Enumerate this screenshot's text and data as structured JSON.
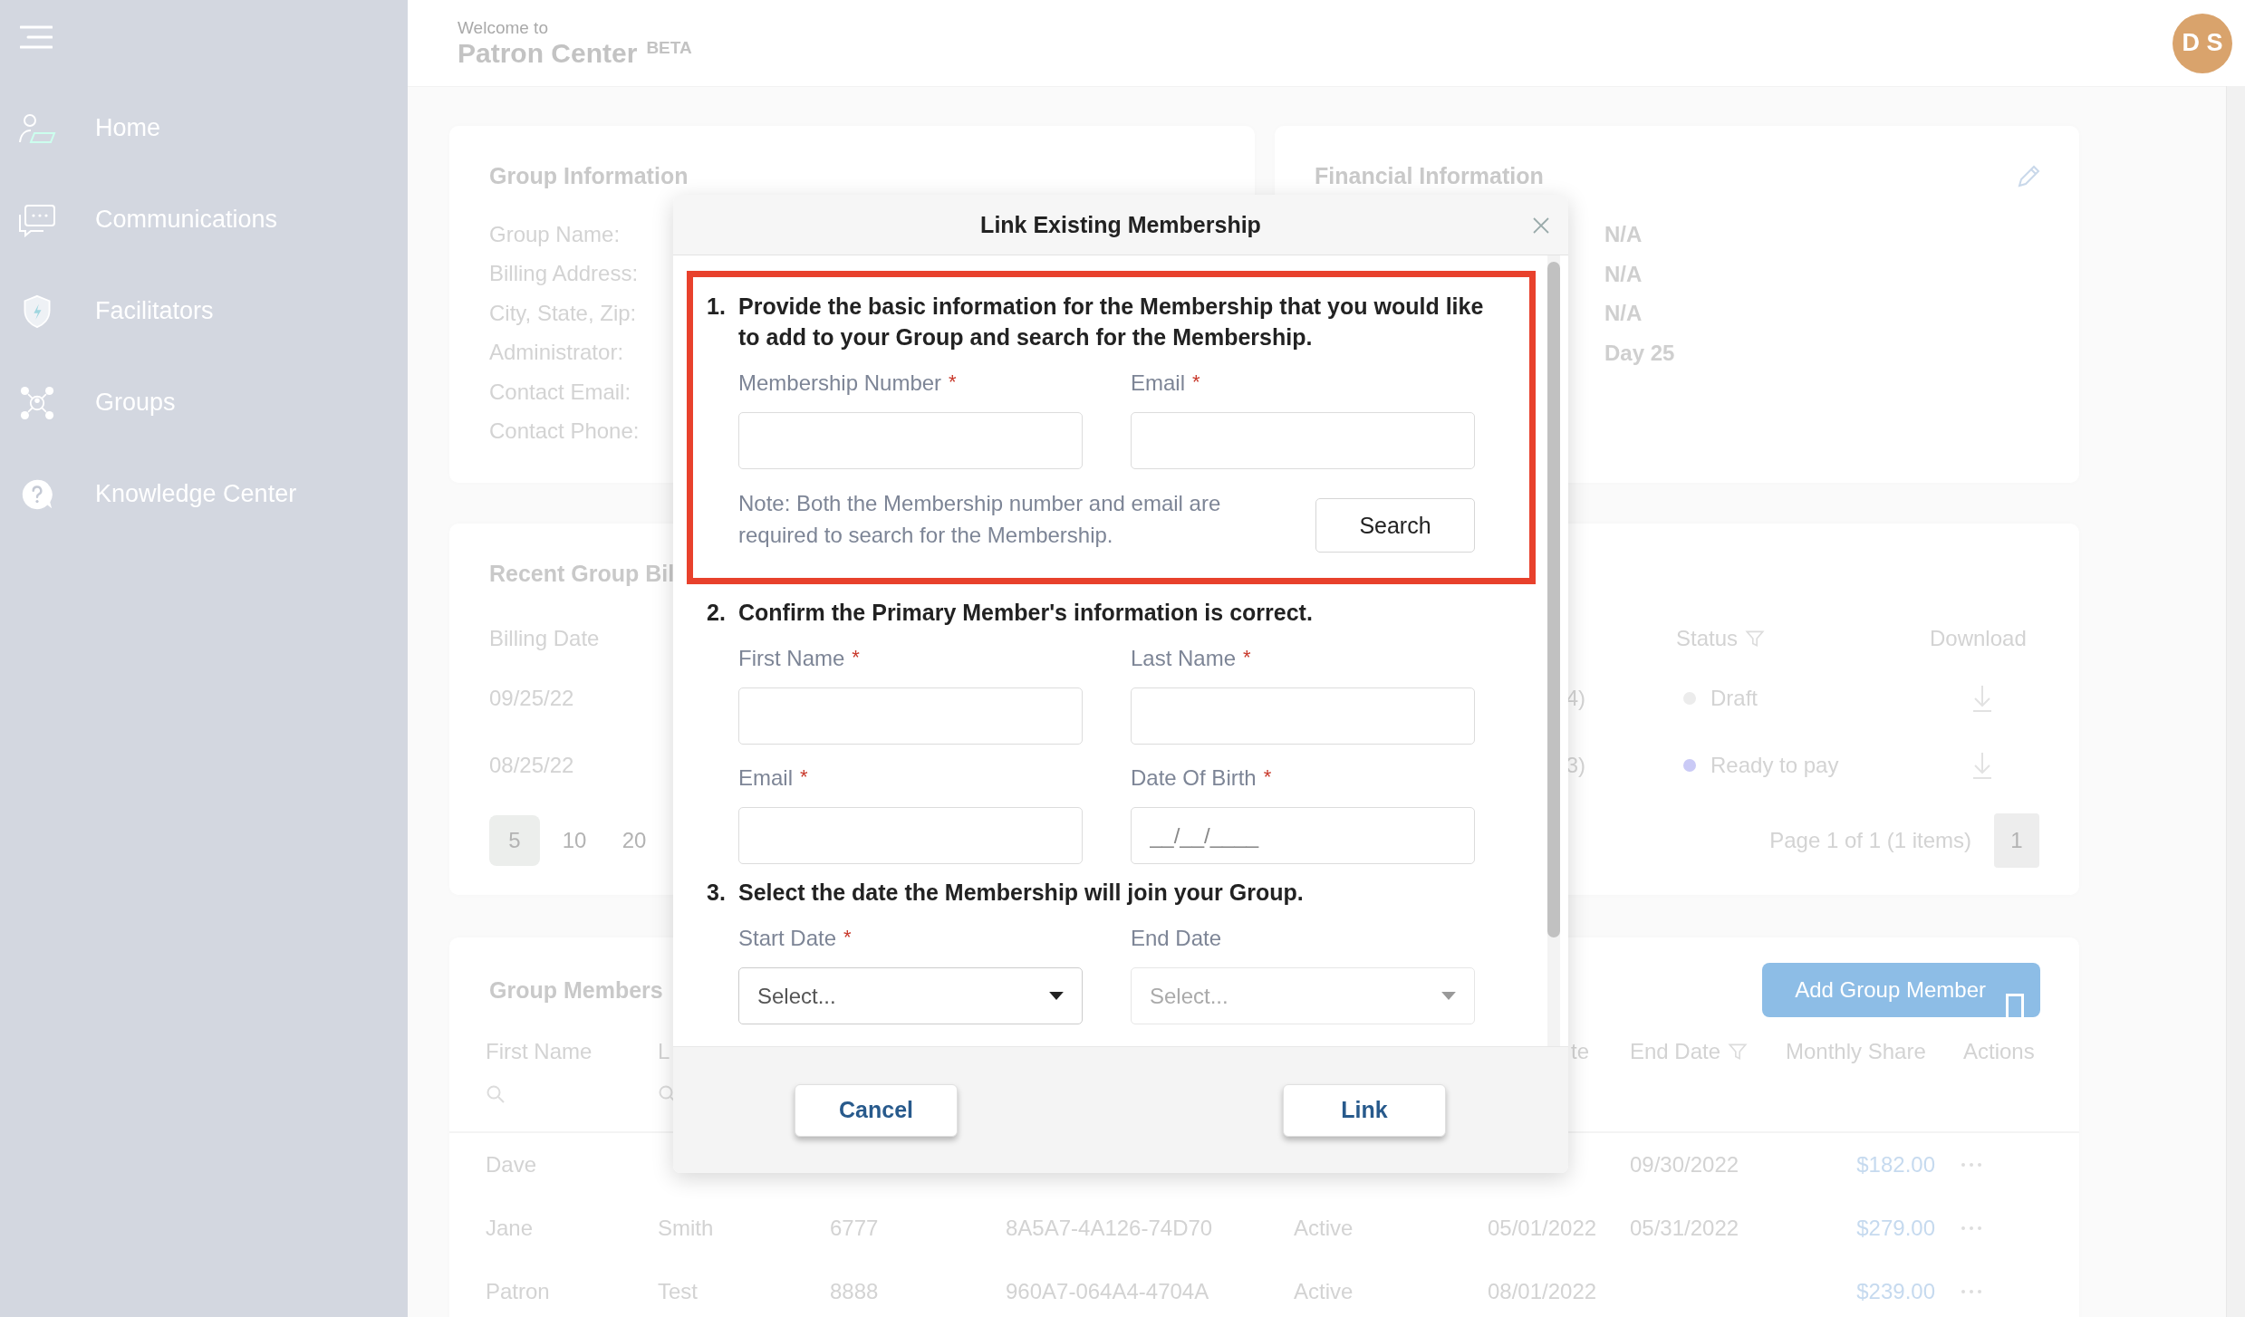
{
  "sidebar": {
    "items": [
      {
        "label": "Home"
      },
      {
        "label": "Communications"
      },
      {
        "label": "Facilitators"
      },
      {
        "label": "Groups"
      },
      {
        "label": "Knowledge Center"
      }
    ]
  },
  "header": {
    "welcome": "Welcome to",
    "title": "Patron Center",
    "badge": "BETA",
    "avatar": "D S"
  },
  "group_information": {
    "title": "Group Information",
    "labels": [
      "Group Name:",
      "Billing Address:",
      "City, State, Zip:",
      "Administrator:",
      "Contact Email:",
      "Contact Phone:"
    ]
  },
  "financial_information": {
    "title": "Financial Information",
    "values": [
      "N/A",
      "N/A",
      "N/A",
      "Day 25"
    ]
  },
  "recent_group_billing": {
    "title": "Recent Group Bil",
    "columns": [
      {
        "label": "Billing Date",
        "kind": "plain"
      },
      {
        "label": "Status",
        "kind": "filter"
      },
      {
        "label": "Download",
        "kind": "plain"
      }
    ],
    "rows": [
      {
        "billing_date": "09/25/22",
        "column_2": "4)",
        "status": "Draft",
        "color": "#ececec"
      },
      {
        "billing_date": "08/25/22",
        "column_2": "3)",
        "status": "Ready to pay",
        "color": "#cacaf6"
      }
    ],
    "page_sizes": [
      {
        "label": "5",
        "selected": true
      },
      {
        "label": "10",
        "selected": false
      },
      {
        "label": "20",
        "selected": false
      }
    ],
    "page_info": "Page 1 of 1 (1 items)",
    "pages": [
      {
        "label": "1",
        "selected": true
      }
    ]
  },
  "group_members": {
    "title": "Group Members",
    "add_button": "Add Group Member",
    "columns": [
      {
        "label": "First Name",
        "kind": "search"
      },
      {
        "label": "L",
        "kind": "search"
      },
      {
        "label": "te",
        "kind": "plain"
      },
      {
        "label": "End Date",
        "kind": "filter"
      },
      {
        "label": "Monthly Share",
        "kind": "plain"
      },
      {
        "label": "Actions",
        "kind": "plain"
      }
    ],
    "rows": [
      {
        "first_name": "Dave",
        "end_date": "09/30/2022",
        "monthly_share": "$182.00"
      },
      {
        "first_name": "Jane",
        "last_name": "Smith",
        "number": "6777",
        "id": "8A5A7-4A126-74D70",
        "status": "Active",
        "start_date": "05/01/2022",
        "end_date": "05/31/2022",
        "monthly_share": "$279.00"
      },
      {
        "first_name": "Patron",
        "last_name": "Test",
        "number": "8888",
        "id": "960A7-064A4-4704A",
        "status": "Active",
        "start_date": "08/01/2022",
        "monthly_share": "$239.00"
      }
    ]
  },
  "modal": {
    "title": "Link Existing Membership",
    "steps": [
      {
        "number": "1.",
        "text": "Provide the basic information for the Membership that you would like to add to your Group and search for the Membership.",
        "highlighted": true,
        "fields": [
          {
            "label": "Membership Number",
            "required_mark": "*",
            "kind": "text"
          },
          {
            "label": "Email",
            "required_mark": "*",
            "kind": "text"
          }
        ],
        "note": "Note: Both the Membership number and email are required to search for the Membership.",
        "button": "Search"
      },
      {
        "number": "2.",
        "text": "Confirm the Primary Member's information is correct.",
        "highlighted": false,
        "fields": [
          {
            "label": "First Name",
            "required_mark": "*",
            "kind": "text"
          },
          {
            "label": "Last Name",
            "required_mark": "*",
            "kind": "text"
          },
          {
            "label": "Email",
            "required_mark": "*",
            "kind": "text"
          },
          {
            "label": "Date Of Birth",
            "required_mark": "*",
            "kind": "text",
            "placeholder": "__/__/____"
          }
        ]
      },
      {
        "number": "3.",
        "text": "Select the date the Membership will join your Group.",
        "highlighted": false,
        "fields": [
          {
            "label": "Start Date",
            "required_mark": "*",
            "kind": "select",
            "value": "Select...",
            "disabled": false
          },
          {
            "label": "End Date",
            "kind": "select",
            "value": "Select...",
            "disabled": true
          }
        ]
      }
    ],
    "buttons": [
      "Cancel",
      "Link"
    ]
  }
}
